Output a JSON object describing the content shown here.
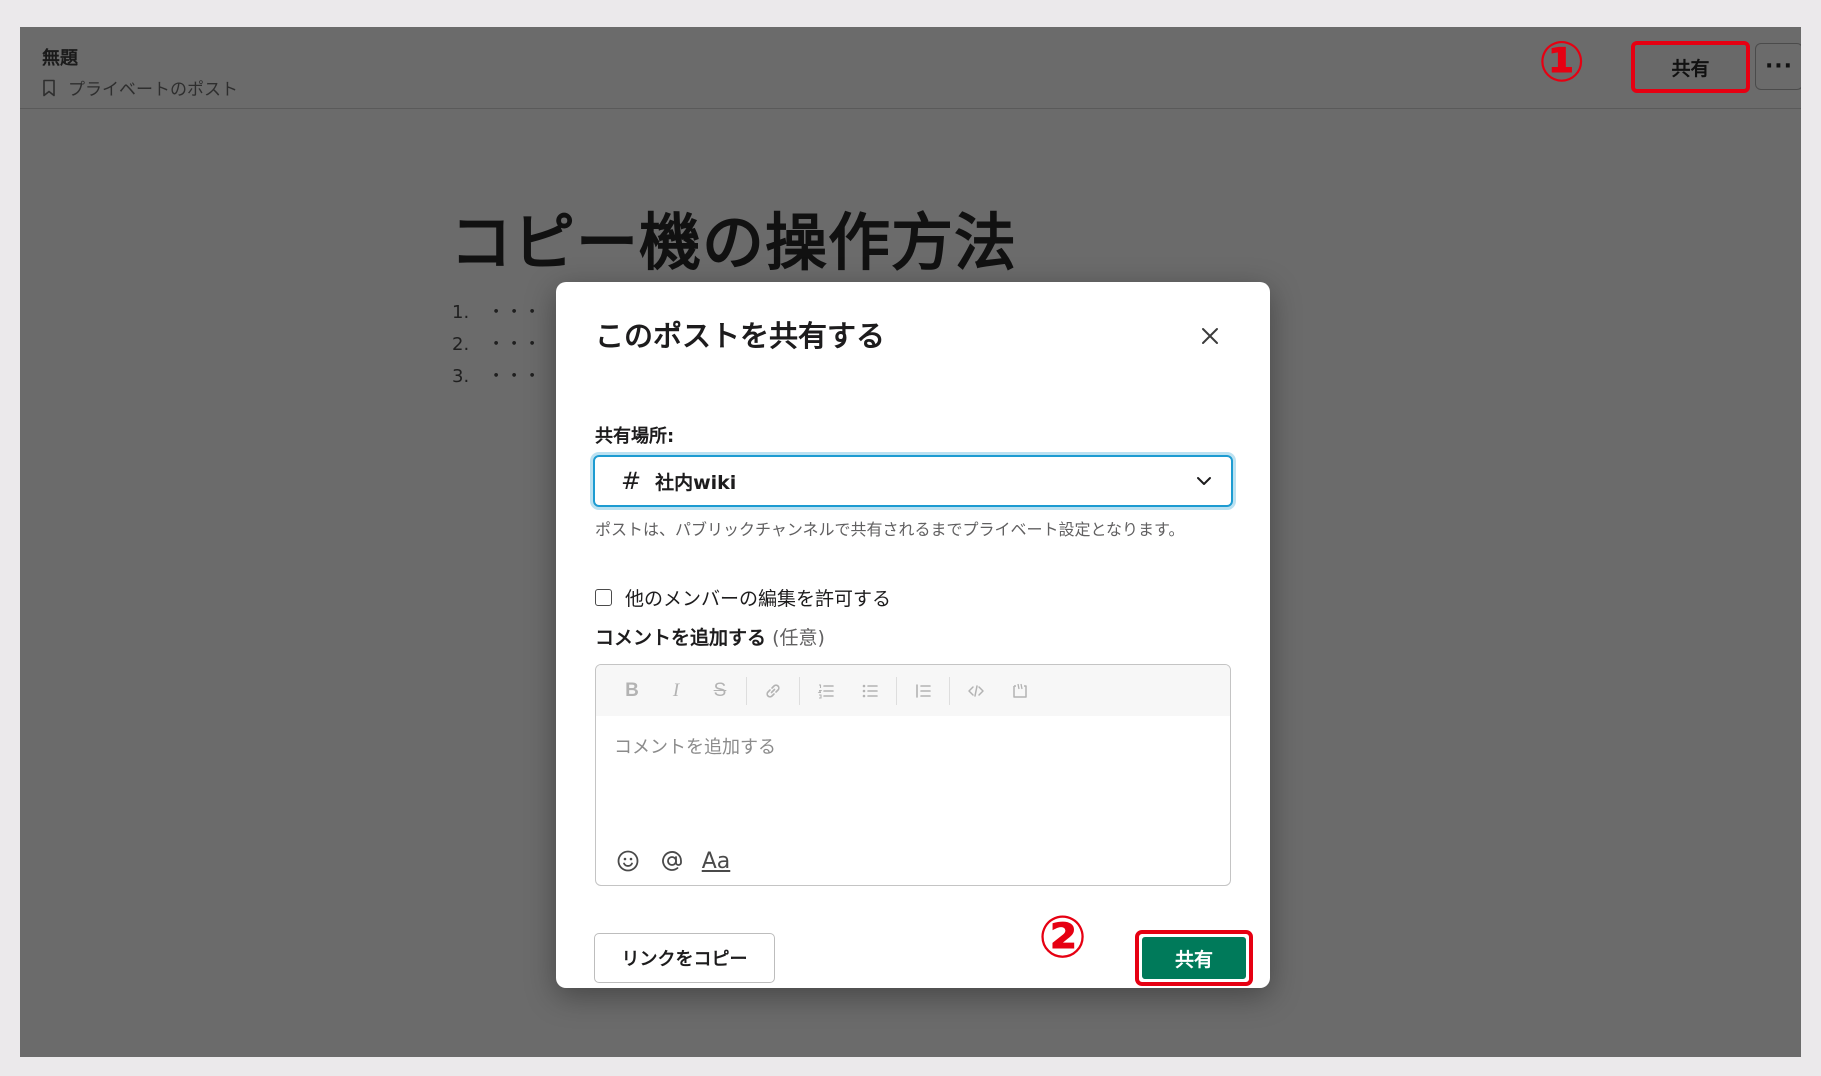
{
  "header": {
    "title": "無題",
    "subtitle": "プライベートのポスト",
    "share_label": "共有",
    "more_label": "···"
  },
  "markers": {
    "step1": "①",
    "step2": "②"
  },
  "doc": {
    "heading": "コピー機の操作方法",
    "list": [
      "1.　・・・",
      "2.　・・・",
      "3.　・・・"
    ]
  },
  "modal": {
    "title": "このポストを共有する",
    "share_to_label": "共有場所:",
    "channel": "社内wiki",
    "channel_icon": "#",
    "help_text": "ポストは、パブリックチャンネルで共有されるまでプライベート設定となります。",
    "allow_edit_label": "他のメンバーの編集を許可する",
    "allow_edit_checked": false,
    "comment_label": "コメントを追加する",
    "comment_optional": "(任意)",
    "comment_placeholder": "コメントを追加する",
    "aa_label": "Aa",
    "copy_link_label": "リンクをコピー",
    "share_label": "共有"
  },
  "colors": {
    "overlay": "#6b6b6b",
    "primary_button": "#007a5a",
    "annotation_red": "#e60012",
    "focus_blue": "#1d9bd1"
  },
  "icons": [
    "bookmark-icon",
    "close-icon",
    "chevron-down-icon",
    "hash-icon",
    "bold-icon",
    "italic-icon",
    "strikethrough-icon",
    "link-icon",
    "ordered-list-icon",
    "bulleted-list-icon",
    "blockquote-icon",
    "code-icon",
    "code-block-icon",
    "emoji-icon",
    "mention-icon"
  ]
}
